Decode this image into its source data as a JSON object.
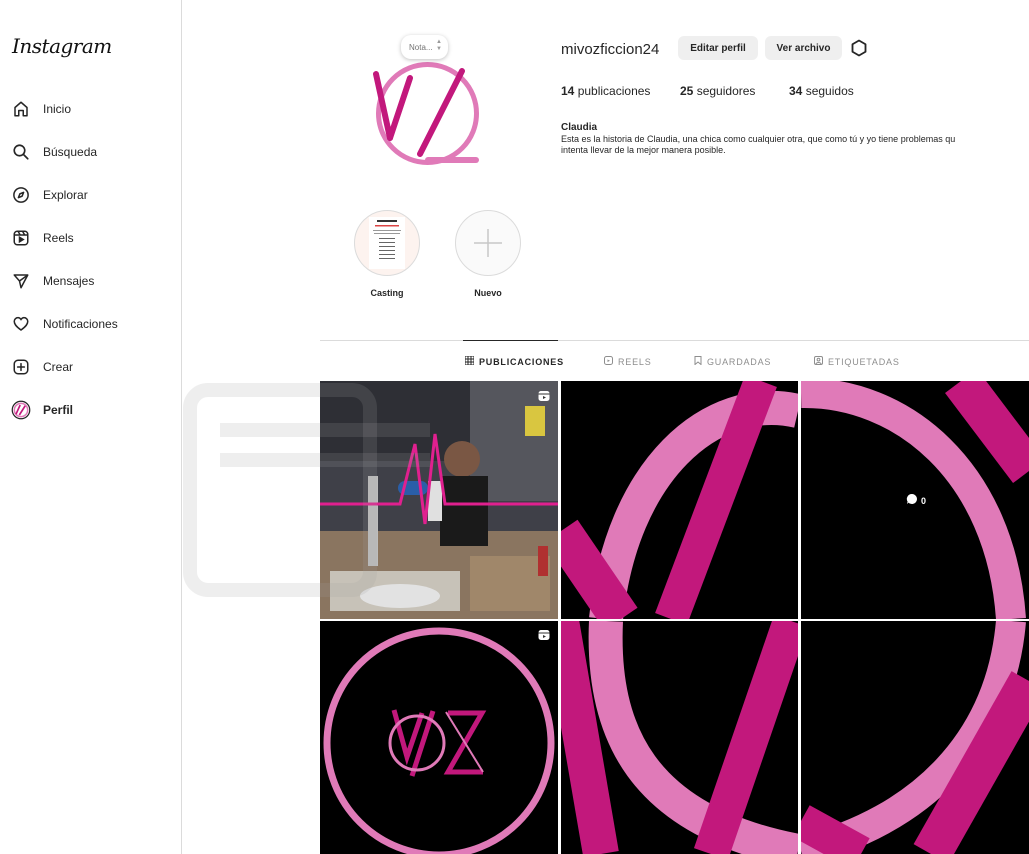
{
  "sidebar": {
    "logo": "Instagram",
    "items": [
      {
        "label": "Inicio",
        "icon": "home-icon"
      },
      {
        "label": "Búsqueda",
        "icon": "search-icon"
      },
      {
        "label": "Explorar",
        "icon": "compass-icon"
      },
      {
        "label": "Reels",
        "icon": "reels-icon"
      },
      {
        "label": "Mensajes",
        "icon": "paper-plane-icon"
      },
      {
        "label": "Notificaciones",
        "icon": "heart-icon"
      },
      {
        "label": "Crear",
        "icon": "plus-square-icon"
      },
      {
        "label": "Perfil",
        "icon": "profile-avatar-icon"
      }
    ]
  },
  "profile": {
    "note_placeholder": "Nota...",
    "username": "mivozficcion24",
    "edit_button": "Editar perfil",
    "archive_button": "Ver archivo",
    "stats": {
      "posts_count": "14",
      "posts_label": "publicaciones",
      "followers_count": "25",
      "followers_label": "seguidores",
      "following_count": "34",
      "following_label": "seguidos"
    },
    "display_name": "Claudia",
    "bio_line1": "Esta es la historia de Claudia, una chica como cualquier otra, que como tú y yo tiene problemas qu",
    "bio_line2": "intenta llevar de la mejor manera posible."
  },
  "highlights": [
    {
      "label": "Casting"
    },
    {
      "label": "Nuevo"
    }
  ],
  "tabs": [
    {
      "label": "PUBLICACIONES",
      "icon": "grid-icon",
      "active": true
    },
    {
      "label": "REELS",
      "icon": "reels-tab-icon",
      "active": false
    },
    {
      "label": "GUARDADAS",
      "icon": "bookmark-icon",
      "active": false
    },
    {
      "label": "ETIQUETADAS",
      "icon": "tag-person-icon",
      "active": false
    }
  ],
  "posts": {
    "hover_comment_count": "0"
  },
  "colors": {
    "brand_magenta": "#c2187c",
    "brand_pink": "#e07ab8",
    "button_bg": "#efefef"
  }
}
